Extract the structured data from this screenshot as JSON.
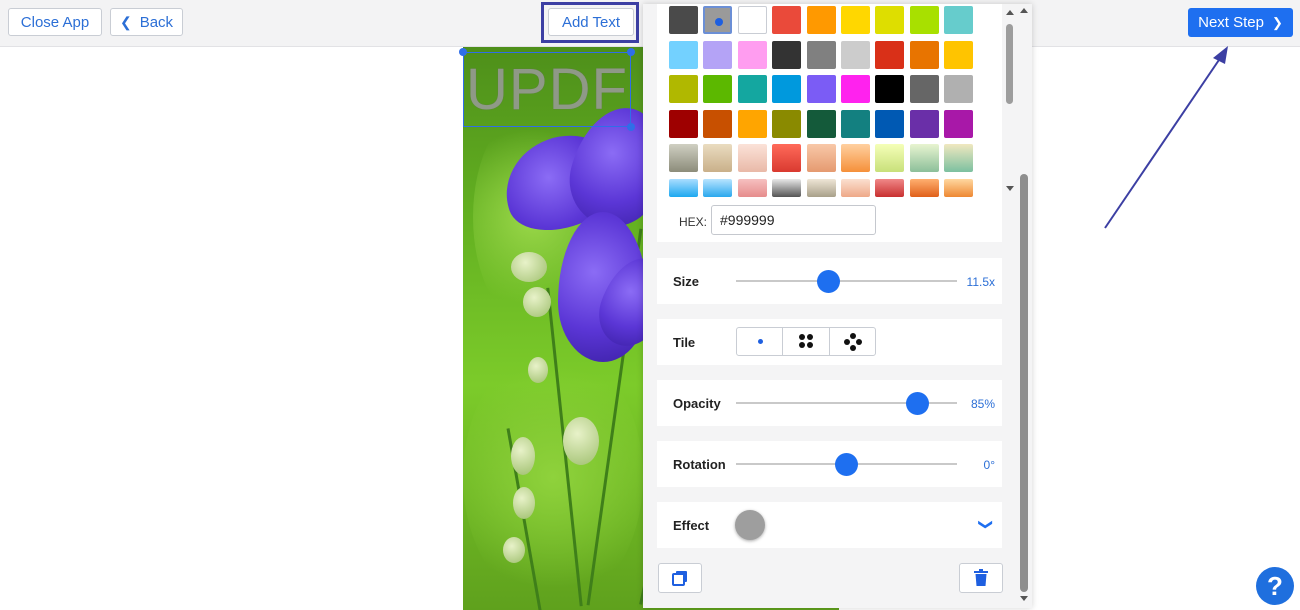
{
  "toolbar": {
    "close_label": "Close App",
    "back_label": "Back",
    "add_text_label": "Add Text",
    "next_label": "Next Step"
  },
  "watermark": {
    "text": "UPDF"
  },
  "colors": {
    "rows": [
      [
        "#4a4a4a",
        "#9a9a9a",
        "#ffffff",
        "#ea4a3a",
        "#ff9900",
        "#ffd700",
        "#dede00",
        "#a8e000",
        "#66cccc"
      ],
      [
        "#73d1ff",
        "#b4a3f6",
        "#ff9df0",
        "#333333",
        "#808080",
        "#cccccc",
        "#d93018",
        "#e87400",
        "#ffc400"
      ],
      [
        "#b0b800",
        "#5cb800",
        "#14a7a0",
        "#0099dd",
        "#7b5cf5",
        "#ff22ee",
        "#000000",
        "#666666",
        "#b0b0b0"
      ],
      [
        "#9e0000",
        "#c85000",
        "#ffa500",
        "#8a8a00",
        "#145a3a",
        "#138080",
        "#0059b3",
        "#6a2fa8",
        "#a818a8"
      ],
      [
        "gradient:#cfcfc2:#8c8c7a",
        "gradient:#eadcc0:#c9b08a",
        "gradient:#fbe2d8:#e9b9a8",
        "gradient:#ff6a5a:#d93a30",
        "gradient:#f8c8a8:#e59a70",
        "gradient:#ffd0a0:#f5903a",
        "gradient:#f5ffb8:#c8e07a",
        "gradient:#e8f4d0:#8cbf9a",
        "gradient:#f0e8c0:#7cc0a0"
      ],
      [
        "gradient:#aaddff:#1ca8f0",
        "gradient:#b8e4ff:#2aa8ee",
        "gradient:#f6c0c0:#e68c8c",
        "gradient:#e8e8e8:#555555",
        "gradient:#efe6d6:#a8a08a",
        "gradient:#fbe0d0:#eea888",
        "gradient:#f08888:#c83030",
        "gradient:#ffb070:#e0601a",
        "gradient:#ffd8a0:#ee8833"
      ]
    ],
    "selected": "#9a9a9a"
  },
  "hex": {
    "label": "HEX:",
    "value": "#999999"
  },
  "controls": {
    "size": {
      "label": "Size",
      "value_text": "11.5x",
      "fraction": 0.42
    },
    "tile": {
      "label": "Tile",
      "selected": "single"
    },
    "opacity": {
      "label": "Opacity",
      "value_text": "85%",
      "fraction": 0.82
    },
    "rotation": {
      "label": "Rotation",
      "value_text": "0°",
      "fraction": 0.5
    },
    "effect": {
      "label": "Effect",
      "color": "#9e9e9e"
    }
  },
  "help": {
    "label": "?"
  }
}
